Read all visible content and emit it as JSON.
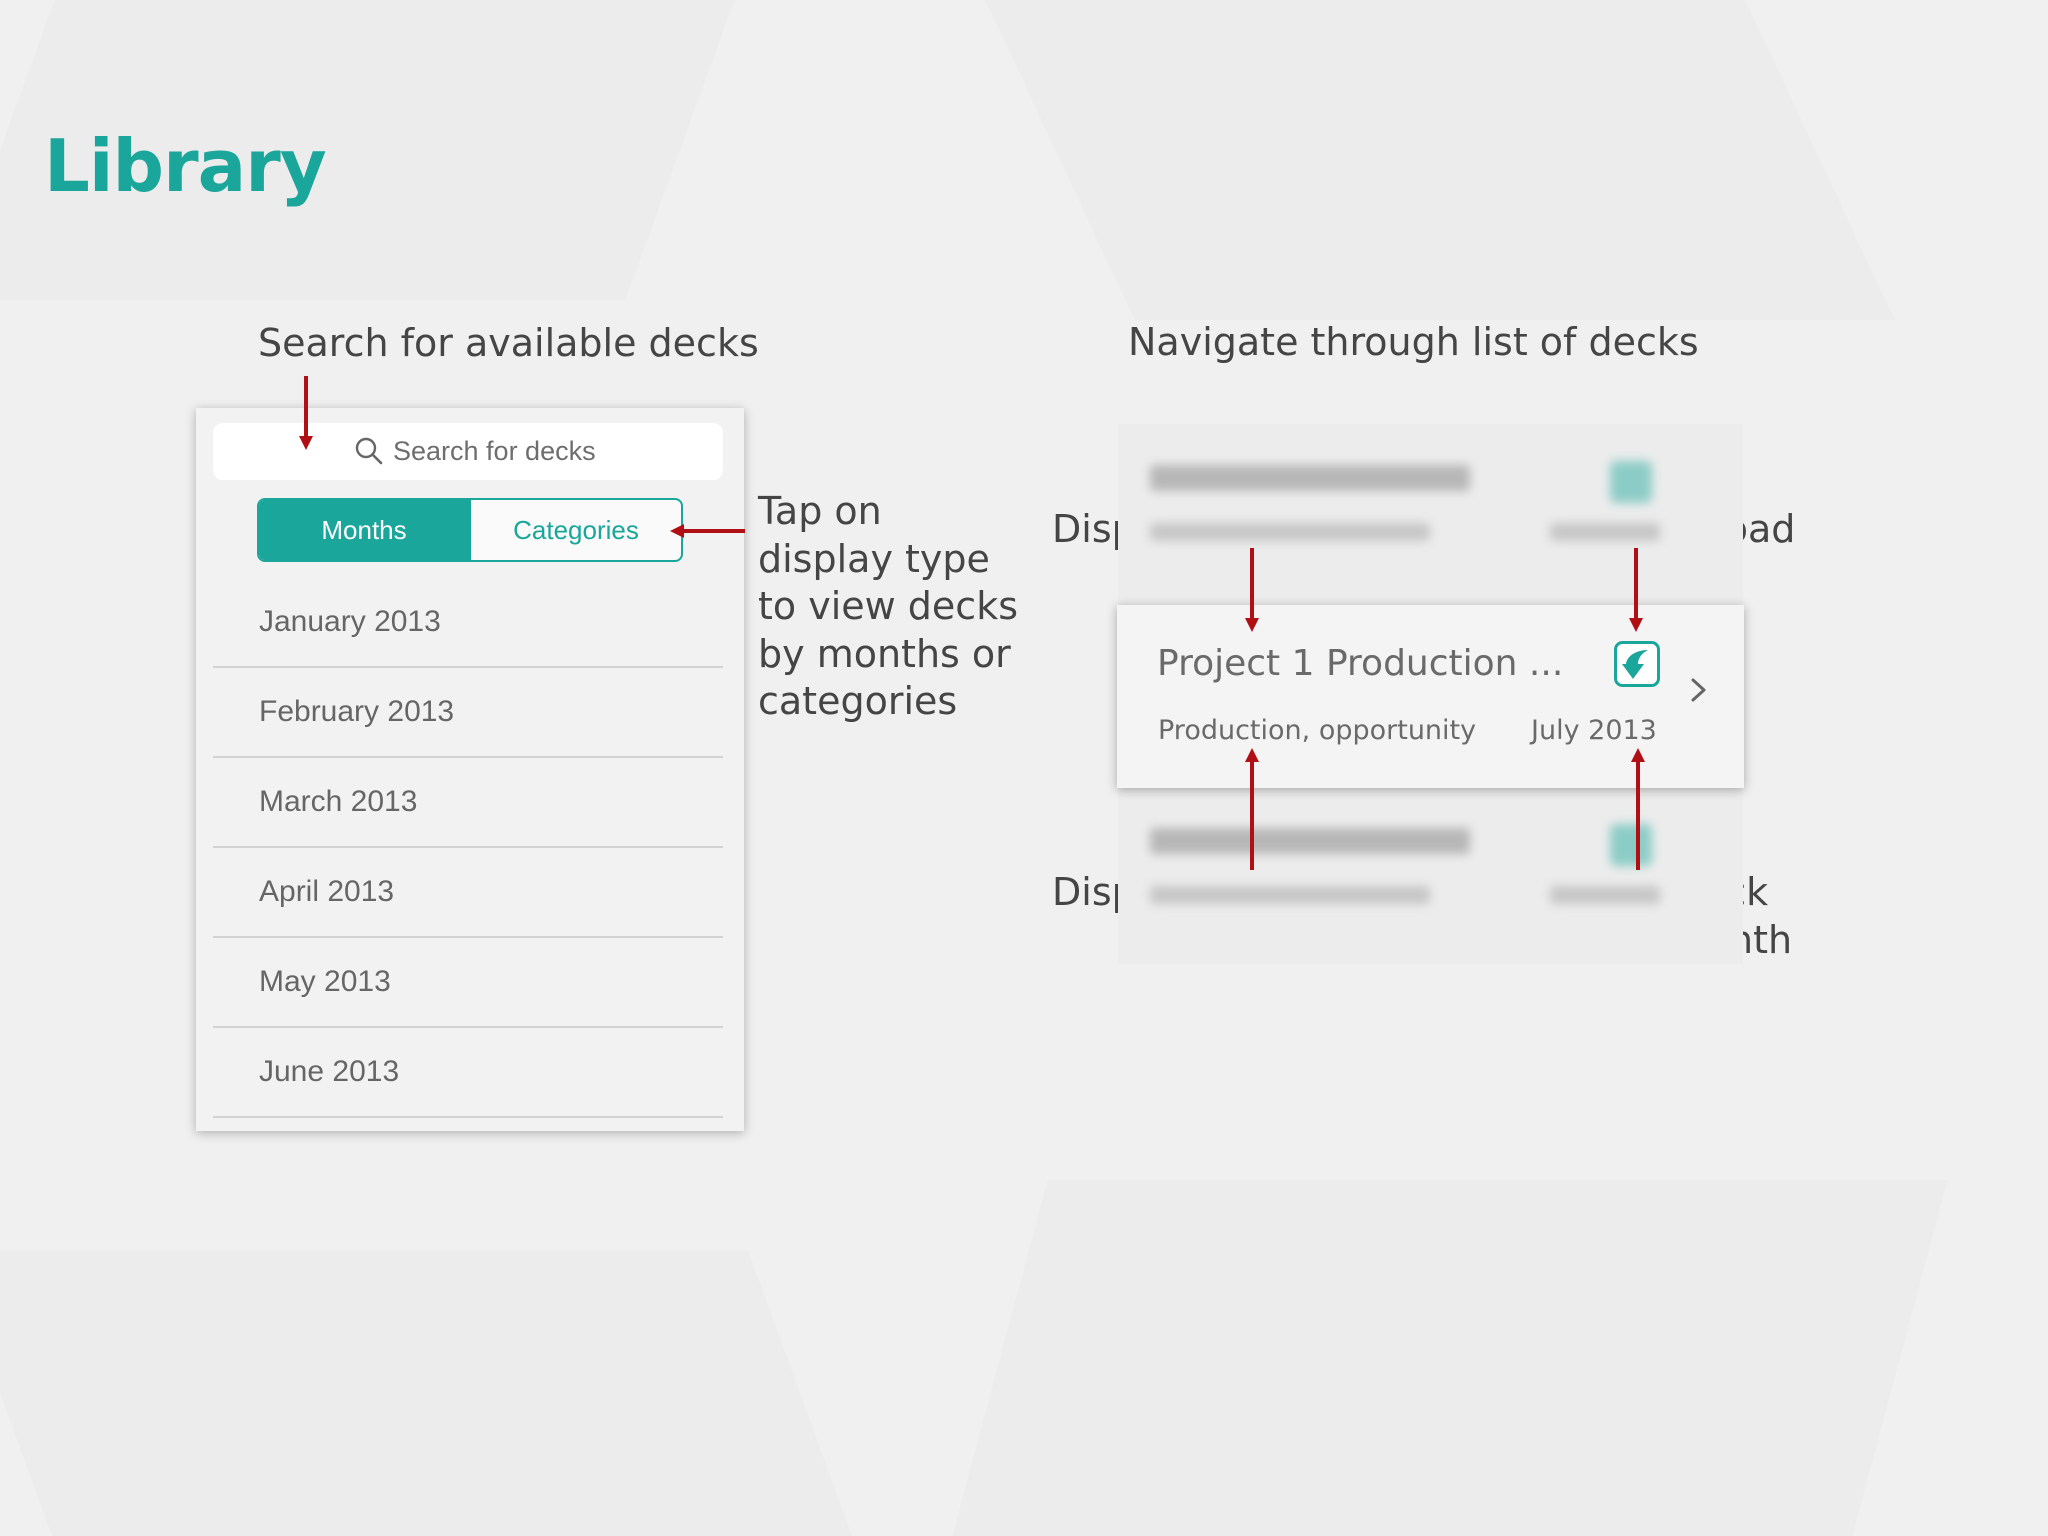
{
  "page": {
    "title": "Library"
  },
  "annotations": {
    "search": "Search for available decks",
    "navigate": "Navigate through list of decks",
    "display_type": [
      "Tap on",
      "display type",
      "to view decks",
      "by months or",
      "categories"
    ],
    "deck_name": "Displays deck name",
    "download": "Tap to download",
    "deck_tags": "Displays deck tags",
    "reporting_month": [
      "Displays deck",
      "reporting month"
    ]
  },
  "search": {
    "placeholder": "Search for decks",
    "value": "",
    "icon": "search-icon"
  },
  "segmented": {
    "months_label": "Months",
    "categories_label": "Categories",
    "selected": "Months"
  },
  "months": [
    "January 2013",
    "February 2013",
    "March 2013",
    "April 2013",
    "May 2013",
    "June 2013"
  ],
  "deck": {
    "name": "Project 1 Production ...",
    "tags": "Production, opportunity",
    "date": "July 2013",
    "download_icon": "download-icon",
    "chevron_icon": "chevron-right-icon"
  },
  "colors": {
    "accent": "#1aa69a",
    "arrow": "#b01015",
    "background": "#f0f0f0"
  }
}
